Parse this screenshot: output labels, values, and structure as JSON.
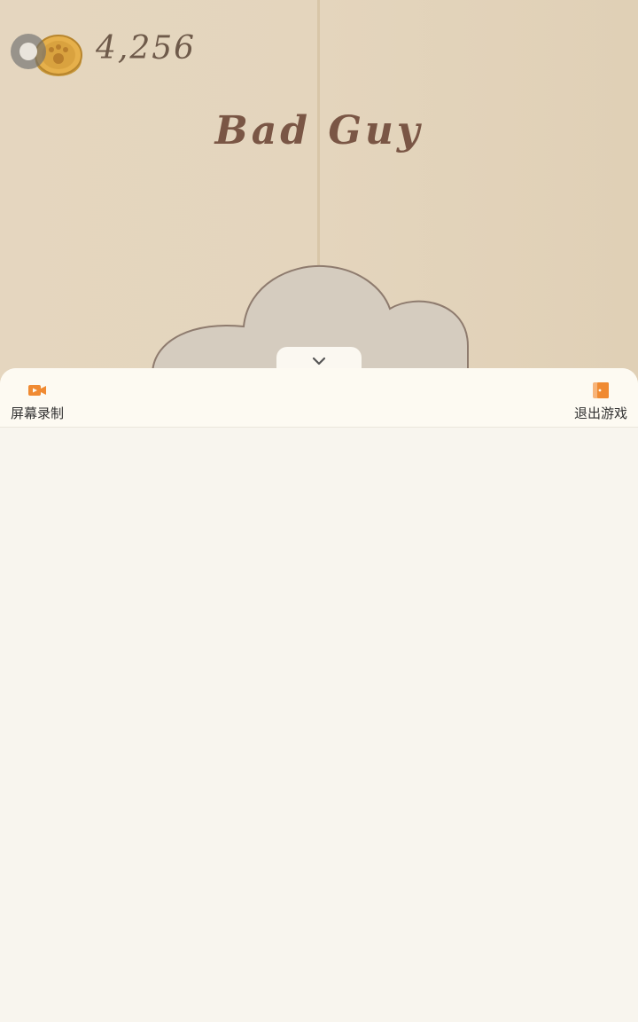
{
  "game": {
    "coin_count": "4,256",
    "song_title": "Bad Guy"
  },
  "menu": {
    "screen_record_label": "屏幕录制",
    "exit_game_label": "退出游戏"
  },
  "colors": {
    "accent": "#f08a32",
    "scene_bg": "#e4d5bd",
    "title_text": "#7a5645",
    "sheet_bg": "#f8f5ee"
  },
  "icons": {
    "screen_record": "video-camera-icon",
    "exit_game": "exit-door-icon",
    "collapse": "chevron-down-icon",
    "coin": "paw-coin-icon"
  }
}
